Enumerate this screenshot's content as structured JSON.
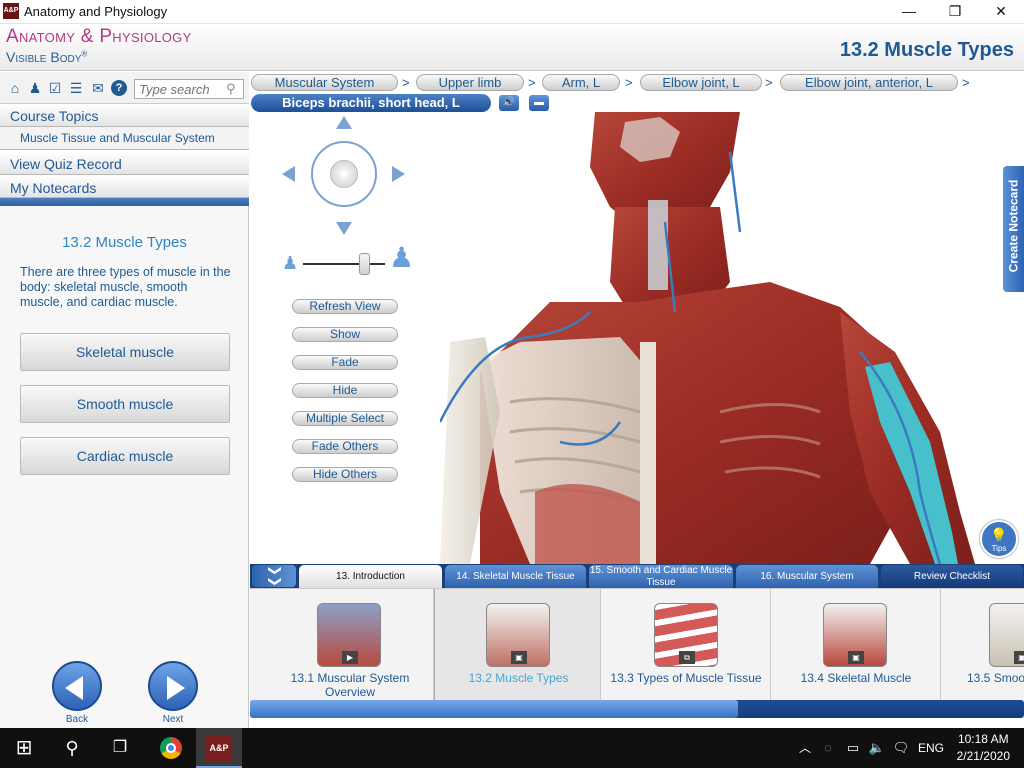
{
  "window": {
    "title": "Anatomy and Physiology",
    "app_icon_text": "A&P",
    "minimize": "—",
    "maximize": "❐",
    "close": "✕"
  },
  "header": {
    "brand_main": "Anatomy & Physiology",
    "brand_sub": "Visible Body",
    "brand_trademark": "®",
    "page_title": "13.2 Muscle Types"
  },
  "toolbar": {
    "icons": [
      "home-icon",
      "person-icon",
      "checklist-icon",
      "list-icon",
      "mail-icon",
      "help-icon"
    ],
    "glyphs": [
      "⌂",
      "♟",
      "☑",
      "☰",
      "✉",
      "?"
    ],
    "search_placeholder": "Type search"
  },
  "sidebar": {
    "course_topics": "Course Topics",
    "course_subitem": "Muscle Tissue and Muscular System",
    "view_quiz": "View Quiz Record",
    "notecards": "My Notecards"
  },
  "section": {
    "title": "13.2 Muscle Types",
    "description": "There are three types of muscle in the body: skeletal muscle, smooth muscle, and cardiac muscle.",
    "buttons": [
      "Skeletal muscle",
      "Smooth muscle",
      "Cardiac muscle"
    ]
  },
  "nav": {
    "back": "Back",
    "next": "Next"
  },
  "breadcrumb": {
    "items": [
      "Muscular System",
      "Upper limb",
      "Arm, L",
      "Elbow joint, L",
      "Elbow joint, anterior, L"
    ],
    "separator": ">"
  },
  "structure": {
    "current": "Biceps brachii, short head, L",
    "audio_icon": "🔊",
    "book_icon": "▬"
  },
  "view_controls": {
    "buttons": [
      "Refresh View",
      "Show",
      "Fade",
      "Hide",
      "Multiple Select",
      "Fade Others",
      "Hide Others"
    ],
    "zoom_level": 0.78
  },
  "side_tab": {
    "create_notecard": "Create Notecard"
  },
  "tips": {
    "label": "Tips"
  },
  "tabs": {
    "collapse_icon": "❯❯",
    "items": [
      {
        "label": "13. Introduction",
        "active": true
      },
      {
        "label": "14. Skeletal Muscle Tissue",
        "active": false
      },
      {
        "label": "15. Smooth and Cardiac Muscle Tissue",
        "active": false
      },
      {
        "label": "16. Muscular System",
        "active": false
      },
      {
        "label": "Review Checklist",
        "active": false
      }
    ]
  },
  "thumbnails": {
    "items": [
      {
        "label": "13.1 Muscular System Overview",
        "selected": false,
        "badge": "▶"
      },
      {
        "label": "13.2 Muscle Types",
        "selected": true,
        "badge": "▣"
      },
      {
        "label": "13.3 Types of Muscle Tissue",
        "selected": false,
        "badge": "⧉"
      },
      {
        "label": "13.4 Skeletal Muscle",
        "selected": false,
        "badge": "▣"
      },
      {
        "label": "13.5 Smoo",
        "selected": false,
        "badge": "▣"
      }
    ],
    "scroll_progress": 0.63
  },
  "taskbar": {
    "start_icon": "⊞",
    "search_icon": "⚲",
    "taskview_icon": "❐",
    "tray_caret": "︿",
    "language": "ENG",
    "time": "10:18 AM",
    "date": "2/21/2020",
    "notification_icon": "🗨"
  },
  "colors": {
    "accent": "#1f5a93",
    "brand_pink": "#b23a82",
    "highlight_muscle": "#48c0cc",
    "muscle_red": "#a8322a"
  }
}
